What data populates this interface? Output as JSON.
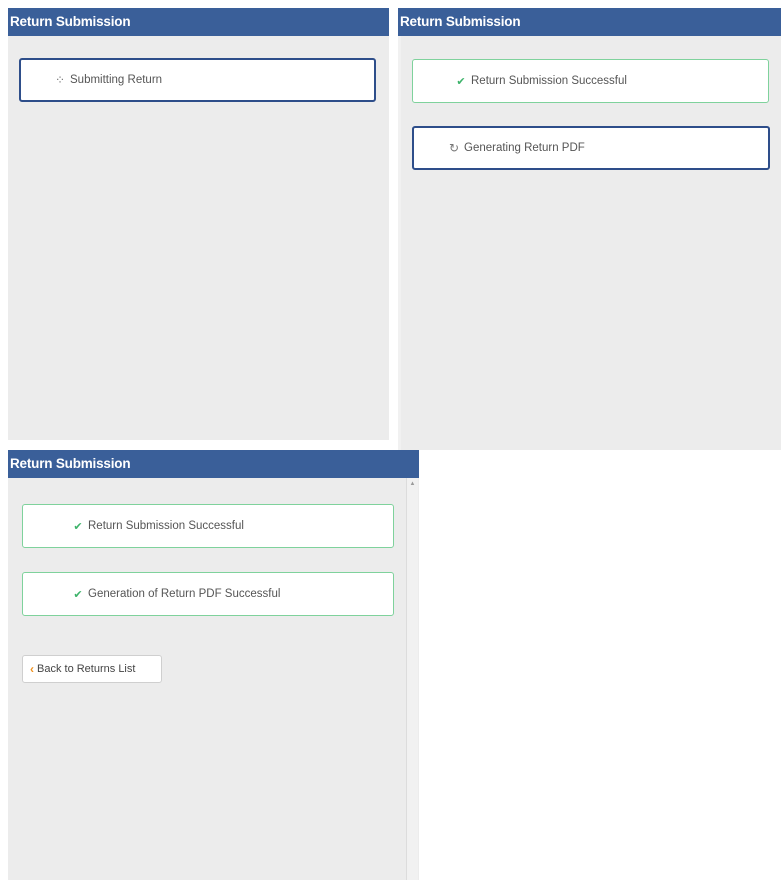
{
  "panel1": {
    "title": "Return Submission",
    "status": {
      "icon": "spinner-icon",
      "glyph": "⁘",
      "text": "Submitting Return"
    }
  },
  "panel2": {
    "title": "Return Submission",
    "statuses": [
      {
        "icon": "check-icon",
        "glyph": "✔",
        "text": "Return Submission Successful"
      },
      {
        "icon": "spinner-icon",
        "glyph": "↻",
        "text": "Generating Return PDF"
      }
    ]
  },
  "panel3": {
    "title": "Return Submission",
    "statuses": [
      {
        "icon": "check-icon",
        "glyph": "✔",
        "text": "Return Submission Successful"
      },
      {
        "icon": "check-icon",
        "glyph": "✔",
        "text": "Generation of Return PDF Successful"
      }
    ],
    "back_button": {
      "icon": "chevron-left-icon",
      "glyph": "‹",
      "label": "Back to Returns List"
    }
  },
  "colors": {
    "header": "#3a5f99",
    "panel_bg": "#ececec",
    "pending_border": "#2e4e8a",
    "success_border": "#7fd29c",
    "check": "#3db36a",
    "chevron": "#f0921f"
  }
}
